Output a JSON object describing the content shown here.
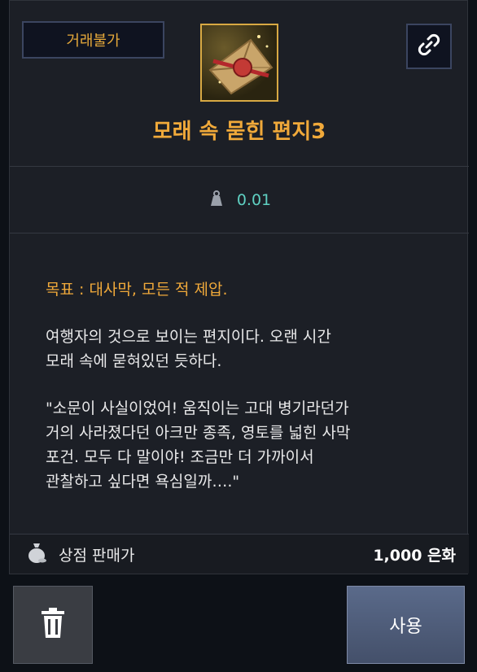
{
  "item": {
    "trade_tag": "거래불가",
    "name": "모래 속 묻힌 편지3",
    "weight": "0.01",
    "goal": "목표 : 대사막, 모든 적 제압.",
    "description_1_line1": "여행자의 것으로 보이는 편지이다. 오랜 시간",
    "description_1_line2": "모래 속에 묻혀있던 듯하다.",
    "quote_line1": "\"소문이 사실이었어! 움직이는 고대 병기라던가",
    "quote_line2": "거의 사라졌다던 아크만 종족, 영토를 넓힌 사막",
    "quote_line3": "포건. 모두 다 말이야! 조금만 더 가까이서",
    "quote_line4": "관찰하고 싶다면 욕심일까….\""
  },
  "shop": {
    "label": "상점 판매가",
    "price": "1,000 은화"
  },
  "actions": {
    "use_label": "사용"
  },
  "icons": {
    "link": "link-icon",
    "weight": "weight-icon",
    "money": "money-bag-icon",
    "trash": "trash-icon",
    "item": "sealed-letter-icon"
  },
  "colors": {
    "accent_gold": "#f0a93a",
    "weight_teal": "#5fd0c2",
    "tag_border": "#3b4560"
  }
}
